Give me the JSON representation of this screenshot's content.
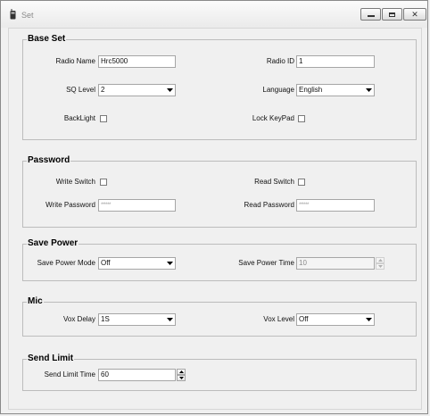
{
  "window": {
    "title": "Set"
  },
  "base_set": {
    "title": "Base Set",
    "radio_name": {
      "label": "Radio Name",
      "value": "Hrc5000"
    },
    "radio_id": {
      "label": "Radio ID",
      "value": "1"
    },
    "sq_level": {
      "label": "SQ Level",
      "value": "2"
    },
    "language": {
      "label": "Language",
      "value": "English"
    },
    "backlight": {
      "label": "BackLight",
      "checked": false
    },
    "lock_keypad": {
      "label": "Lock KeyPad",
      "checked": false
    }
  },
  "password": {
    "title": "Password",
    "write_switch": {
      "label": "Write Switch",
      "checked": false
    },
    "read_switch": {
      "label": "Read Switch",
      "checked": false
    },
    "write_password": {
      "label": "Write Password",
      "value": "******"
    },
    "read_password": {
      "label": "Read Password",
      "value": "******"
    }
  },
  "save_power": {
    "title": "Save Power",
    "mode": {
      "label": "Save Power Mode",
      "value": "Off"
    },
    "time": {
      "label": "Save Power Time",
      "value": "10",
      "enabled": false
    }
  },
  "mic": {
    "title": "Mic",
    "vox_delay": {
      "label": "Vox Delay",
      "value": "1S"
    },
    "vox_level": {
      "label": "Vox Level",
      "value": "Off"
    }
  },
  "send_limit": {
    "title": "Send Limit",
    "time": {
      "label": "Send Limit Time",
      "value": "60"
    }
  }
}
